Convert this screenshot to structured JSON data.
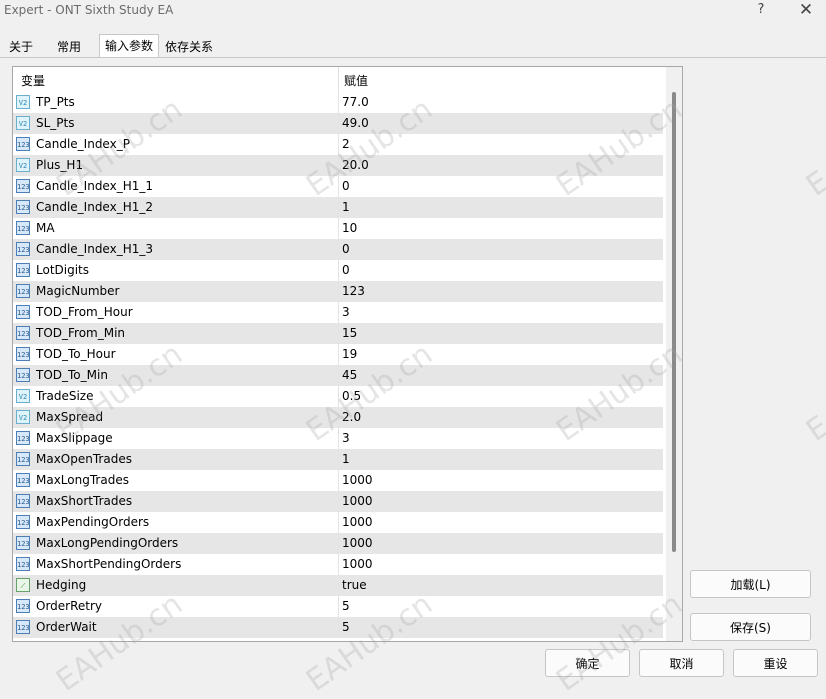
{
  "window": {
    "title": "Expert - ONT Sixth Study EA",
    "help": "?",
    "close": "✕"
  },
  "tabs": [
    {
      "label": "关于"
    },
    {
      "label": "常用"
    },
    {
      "label": "输入参数"
    },
    {
      "label": "依存关系"
    }
  ],
  "active_tab": "输入参数",
  "grid": {
    "col_variable": "变量",
    "col_value": "赋值",
    "rows": [
      {
        "name": "TP_Pts",
        "value": "77.0",
        "icon": "V2"
      },
      {
        "name": "SL_Pts",
        "value": "49.0",
        "icon": "V2"
      },
      {
        "name": "Candle_Index_P",
        "value": "2",
        "icon": "123"
      },
      {
        "name": "Plus_H1",
        "value": "20.0",
        "icon": "V2"
      },
      {
        "name": "Candle_Index_H1_1",
        "value": "0",
        "icon": "123"
      },
      {
        "name": "Candle_Index_H1_2",
        "value": "1",
        "icon": "123"
      },
      {
        "name": "MA",
        "value": "10",
        "icon": "123"
      },
      {
        "name": "Candle_Index_H1_3",
        "value": "0",
        "icon": "123"
      },
      {
        "name": "LotDigits",
        "value": "0",
        "icon": "123"
      },
      {
        "name": "MagicNumber",
        "value": "123",
        "icon": "123"
      },
      {
        "name": "TOD_From_Hour",
        "value": "3",
        "icon": "123"
      },
      {
        "name": "TOD_From_Min",
        "value": "15",
        "icon": "123"
      },
      {
        "name": "TOD_To_Hour",
        "value": "19",
        "icon": "123"
      },
      {
        "name": "TOD_To_Min",
        "value": "45",
        "icon": "123"
      },
      {
        "name": "TradeSize",
        "value": "0.5",
        "icon": "V2"
      },
      {
        "name": "MaxSpread",
        "value": "2.0",
        "icon": "V2"
      },
      {
        "name": "MaxSlippage",
        "value": "3",
        "icon": "123"
      },
      {
        "name": "MaxOpenTrades",
        "value": "1",
        "icon": "123"
      },
      {
        "name": "MaxLongTrades",
        "value": "1000",
        "icon": "123"
      },
      {
        "name": "MaxShortTrades",
        "value": "1000",
        "icon": "123"
      },
      {
        "name": "MaxPendingOrders",
        "value": "1000",
        "icon": "123"
      },
      {
        "name": "MaxLongPendingOrders",
        "value": "1000",
        "icon": "123"
      },
      {
        "name": "MaxShortPendingOrders",
        "value": "1000",
        "icon": "123"
      },
      {
        "name": "Hedging",
        "value": "true",
        "icon": "bool"
      },
      {
        "name": "OrderRetry",
        "value": "5",
        "icon": "123"
      },
      {
        "name": "OrderWait",
        "value": "5",
        "icon": "123"
      }
    ]
  },
  "buttons": {
    "load": "加载(L)",
    "save": "保存(S)",
    "ok": "确定",
    "cancel": "取消",
    "reset": "重设"
  },
  "watermark": "EAHub.cn",
  "colors": {
    "row_alt": "#e6e6e6",
    "row_bg": "#ffffff",
    "window_bg": "#f0f0f0"
  }
}
